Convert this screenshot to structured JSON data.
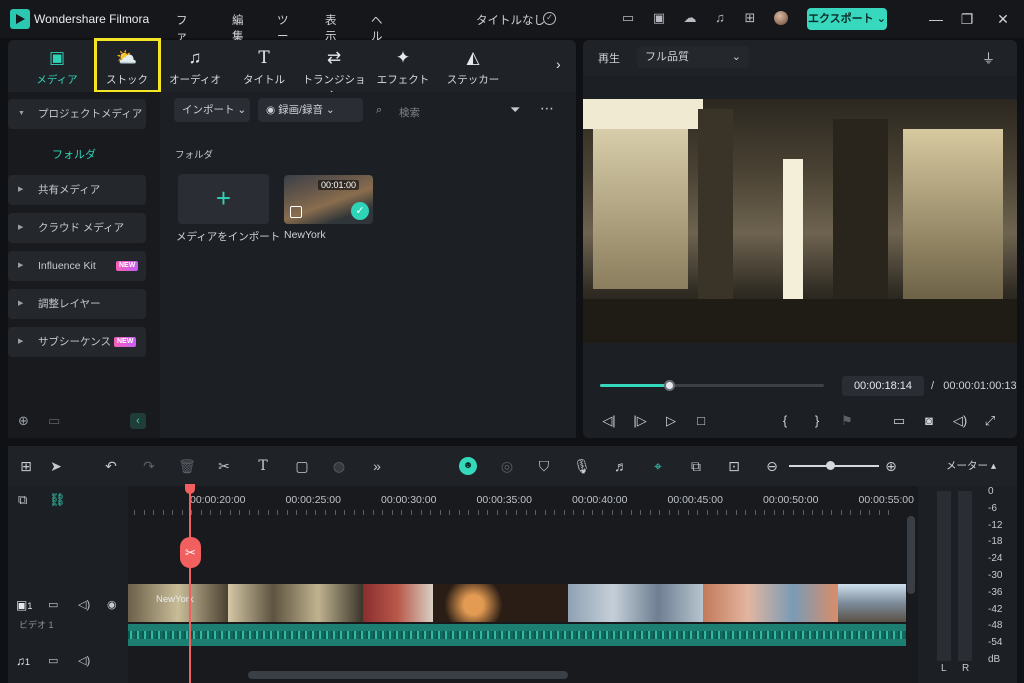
{
  "app": {
    "title": "Wondershare Filmora",
    "menu": [
      "ファイル",
      "編集",
      "ツール",
      "表示",
      "ヘルプ"
    ],
    "project_title": "タイトルなし",
    "export_label": "エクスポート"
  },
  "tabs": [
    {
      "label": "メディア",
      "icon": "media-icon"
    },
    {
      "label": "ストック",
      "icon": "stock-cloud-icon"
    },
    {
      "label": "オーディオ",
      "icon": "music-note-icon"
    },
    {
      "label": "タイトル",
      "icon": "title-t-icon"
    },
    {
      "label": "トランジション",
      "icon": "transition-icon"
    },
    {
      "label": "エフェクト",
      "icon": "effects-icon"
    },
    {
      "label": "ステッカー",
      "icon": "sticker-icon"
    }
  ],
  "sidebar": {
    "project_media": "プロジェクトメディア",
    "folder": "フォルダ",
    "items": [
      {
        "label": "共有メディア",
        "new": ""
      },
      {
        "label": "クラウド メディア",
        "new": ""
      },
      {
        "label": "Influence Kit",
        "new": "NEW"
      },
      {
        "label": "調整レイヤー",
        "new": ""
      },
      {
        "label": "サブシーケンス",
        "new": "NEW"
      }
    ]
  },
  "library": {
    "import_label": "インポート",
    "record_label": "録画/録音",
    "search_placeholder": "検索",
    "folder_label": "フォルダ",
    "import_media_label": "メディアをインポート",
    "clip": {
      "name": "NewYork",
      "duration": "00:01:00"
    }
  },
  "preview": {
    "play_label": "再生",
    "quality": "フル品質",
    "current_time": "00:00:18:14",
    "separator": "/",
    "total_time": "00:00:01:00:13",
    "progress": 0.31
  },
  "timeline": {
    "ruler": [
      "00:00:20:00",
      "00:00:25:00",
      "00:00:30:00",
      "00:00:35:00",
      "00:00:40:00",
      "00:00:45:00",
      "00:00:50:00",
      "00:00:55:00"
    ],
    "video_track_label": "ビデオ 1",
    "video_track_num": "1",
    "audio_track_num": "1",
    "clip_label": "NewYork",
    "zoom": 0.45
  },
  "meter": {
    "title": "メーター",
    "scale": [
      "0",
      "-6",
      "-12",
      "-18",
      "-24",
      "-30",
      "-36",
      "-42",
      "-48",
      "-54",
      "dB"
    ],
    "channels": [
      "L",
      "R"
    ]
  },
  "colors": {
    "accent": "#36d8bc",
    "playhead": "#f25f5f",
    "highlight": "#f4e526"
  }
}
